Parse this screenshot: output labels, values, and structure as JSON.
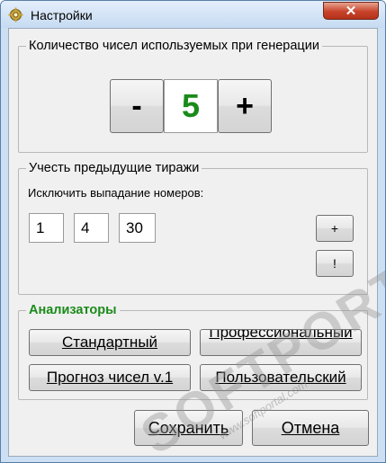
{
  "window": {
    "title": "Настройки",
    "close_label": "✕"
  },
  "numbers_group": {
    "legend": "Количество чисел используемых при генерации",
    "minus_label": "-",
    "value": "5",
    "plus_label": "+"
  },
  "previous_draws": {
    "legend": "Учесть предыдущие тиражи",
    "exclude_label": "Исключить выпадание номеров:",
    "numbers": [
      "1",
      "4",
      "30"
    ],
    "add_label": "+",
    "info_label": "!"
  },
  "analyzers": {
    "legend": "Анализаторы",
    "standard": "Стандартный",
    "professional": "Профессиональный",
    "forecast": "Прогноз чисел v.1",
    "custom": "Пользовательский"
  },
  "footer": {
    "save": "Сохранить",
    "cancel": "Отмена"
  },
  "watermark": {
    "text": "SOFTPORTAL",
    "url": "www.softportal.com"
  },
  "colors": {
    "accent_green": "#1a8a1a",
    "close_red": "#c8432a"
  }
}
